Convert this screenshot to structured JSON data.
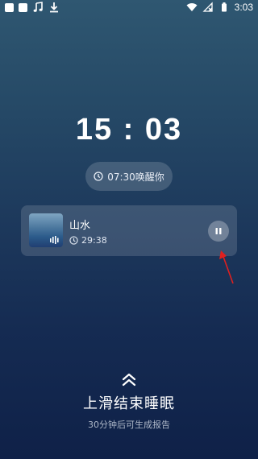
{
  "status_bar": {
    "time": "3:03",
    "left_icons": [
      "app-square-icon",
      "app-square-icon",
      "music-note-icon",
      "download-icon"
    ],
    "right_icons": [
      "wifi-icon",
      "no-signal-icon",
      "battery-icon"
    ]
  },
  "clock": {
    "hours": "15",
    "separator": ":",
    "minutes": "03"
  },
  "alarm": {
    "label": "07:30唤醒你"
  },
  "sound": {
    "title": "山水",
    "timer": "29:38",
    "playing": true
  },
  "bottom": {
    "swipe_label": "上滑结束睡眠",
    "report_hint": "30分钟后可生成报告"
  },
  "colors": {
    "annotation_arrow": "#e0201f",
    "background_top": "#2f5771",
    "background_bottom": "#0f2148"
  }
}
